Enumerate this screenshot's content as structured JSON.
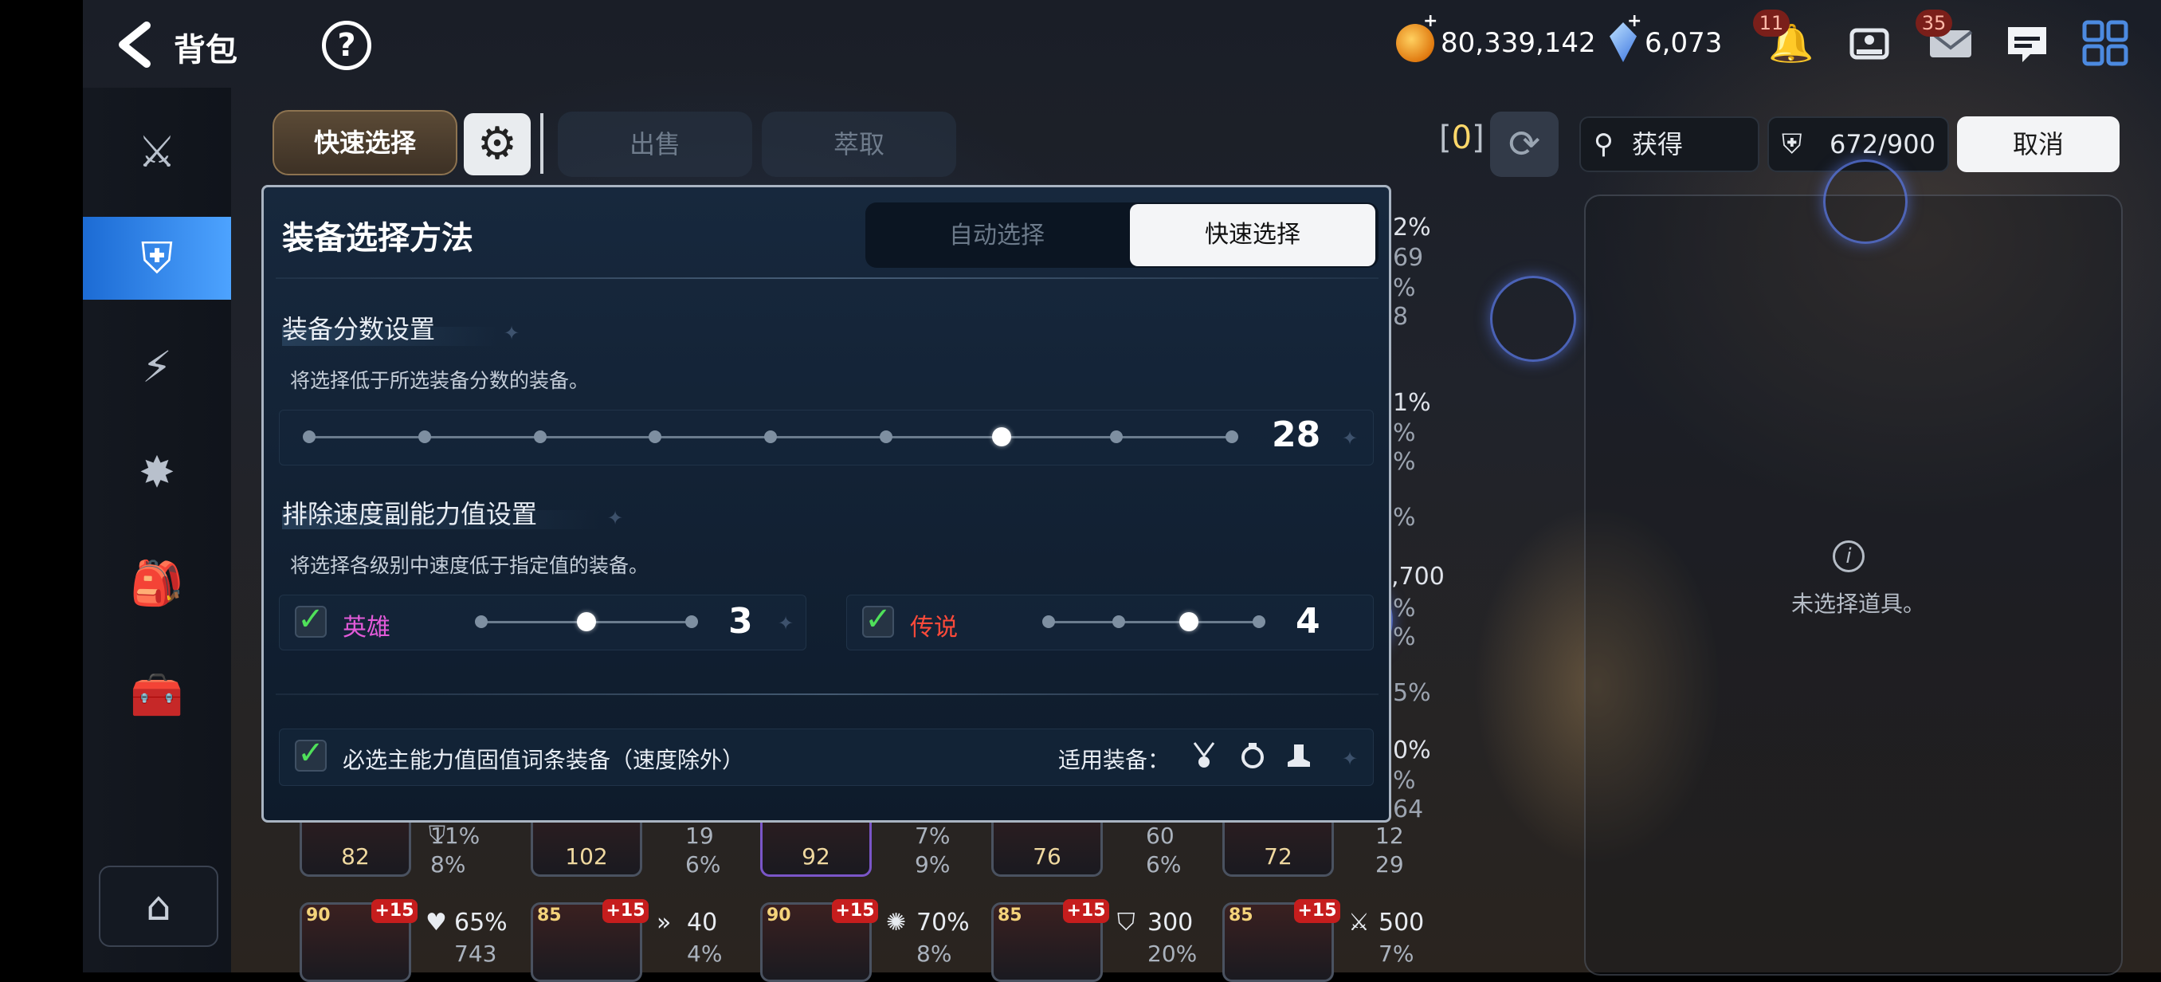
{
  "header": {
    "title": "背包",
    "gold": "80,339,142",
    "crystals": "6,073",
    "currency_plus": "+",
    "notifications_badge": "11",
    "mail_badge": "35"
  },
  "toolbar": {
    "quick_select_tab": "快速选择",
    "sell_tab": "出售",
    "extract_tab": "萃取",
    "selected_prefix": "[",
    "selected_count": "0",
    "selected_suffix": "]",
    "sort_label": "获得",
    "capacity": "672/900",
    "cancel_label": "取消"
  },
  "info_panel": {
    "empty_text": "未选择道具。"
  },
  "modal": {
    "title": "装备选择方法",
    "segment_auto": "自动选择",
    "segment_quick": "快速选择",
    "score_section": {
      "title": "装备分数设置",
      "description": "将选择低于所选装备分数的装备。",
      "value": "28",
      "slider_level": 7,
      "slider_stops": 9
    },
    "speed_section": {
      "title": "排除速度副能力值设置",
      "description": "将选择各级别中速度低于指定值的装备。",
      "hero": {
        "label": "英雄",
        "value": "3",
        "checked": true,
        "level": 2,
        "stops": 3
      },
      "legend": {
        "label": "传说",
        "value": "4",
        "checked": true,
        "level": 3,
        "stops": 4
      }
    },
    "main_stat_option": {
      "label": "必选主能力值固值词条装备（速度除外）",
      "checked": true,
      "applies_label": "适用装备：",
      "equipment_icons": [
        "necklace-icon",
        "ring-icon",
        "boots-icon"
      ]
    }
  },
  "behind_panel_stats": [
    "2%",
    "69",
    "%",
    "8",
    "1%",
    "%",
    "%",
    "%",
    ",700",
    "%",
    "%",
    "5%",
    "0%",
    "%",
    "64"
  ],
  "inventory_row1": [
    {
      "score": "82",
      "stat1": "11%",
      "stat2": "8%"
    },
    {
      "score": "102",
      "stat1": "19",
      "stat2": "6%"
    },
    {
      "score": "92",
      "stat1": "7%",
      "stat2": "9%"
    },
    {
      "score": "76",
      "stat1": "60",
      "stat2": "6%"
    },
    {
      "score": "72",
      "stat1": "12",
      "stat2": "29"
    }
  ],
  "inventory_row2": [
    {
      "level": "90",
      "plus": "+15",
      "stat1": "65%",
      "stat2": "743"
    },
    {
      "level": "85",
      "plus": "+15",
      "stat1": "40",
      "stat2": "4%"
    },
    {
      "level": "90",
      "plus": "+15",
      "stat1": "70%",
      "stat2": "8%"
    },
    {
      "level": "85",
      "plus": "+15",
      "stat1": "300",
      "stat2": "20%"
    },
    {
      "level": "85",
      "plus": "+15",
      "stat1": "500",
      "stat2": "7%"
    }
  ],
  "colors": {
    "hero": "#e25ad8",
    "legend": "#ff4a3a",
    "nav_active": "#2f8cf0",
    "check": "#4fe05a"
  }
}
